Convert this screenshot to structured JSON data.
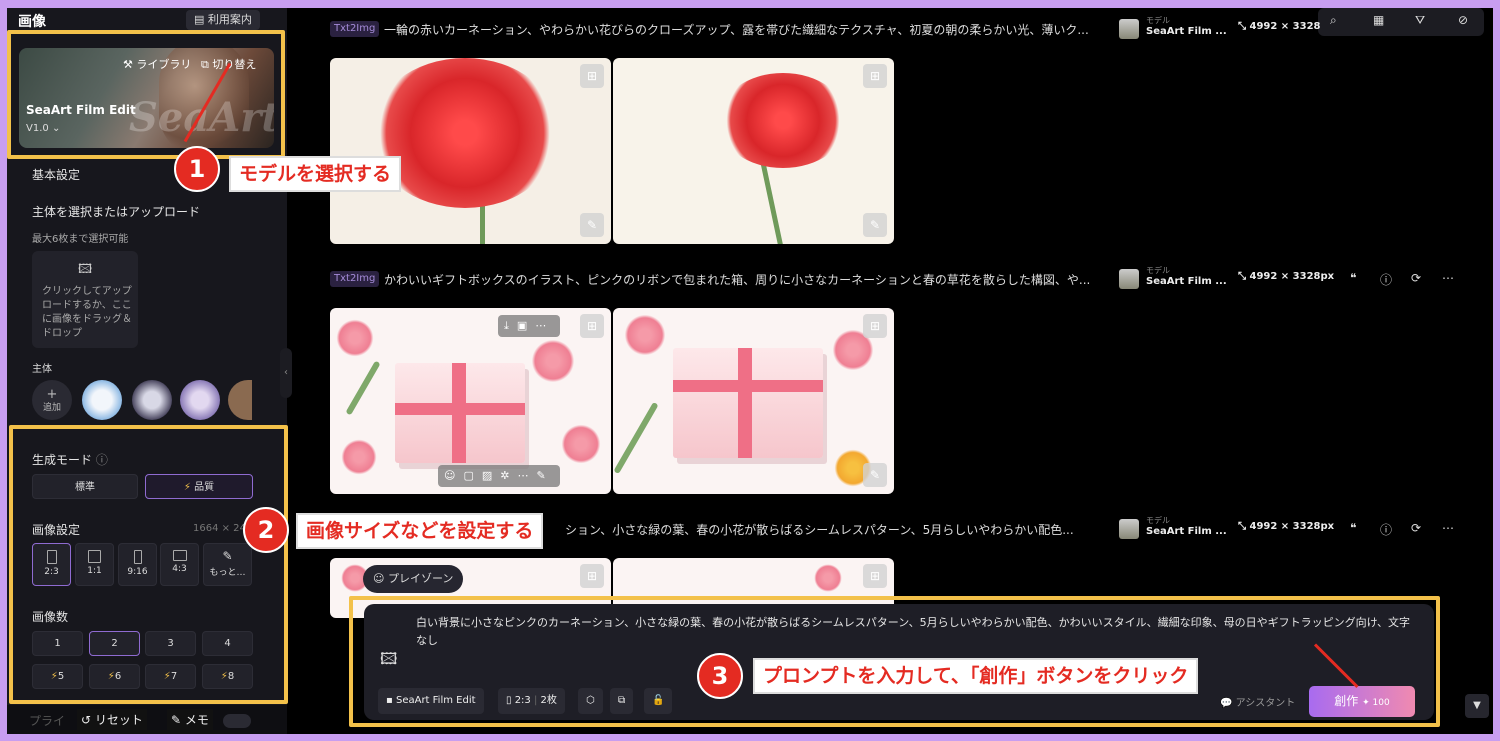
{
  "sidebar": {
    "title": "画像",
    "guide": "利用案内",
    "model_card": {
      "library": "ライブラリ",
      "switch": "切り替え",
      "name": "SeaArt Film Edit",
      "version": "V1.0",
      "watermark": "SeaArt"
    },
    "basic_settings": "基本設定",
    "subject_label": "主体を選択またはアップロード",
    "subject_limit": "最大6枚まで選択可能",
    "upload_text": "クリックしてアップロードするか、ここに画像をドラッグ＆ドロップ",
    "subject": "主体",
    "add": "追加",
    "gen_mode": "生成モード",
    "modes": [
      "標準",
      "品質"
    ],
    "image_settings": "画像設定",
    "image_size_hint": "1664 × 24",
    "ratios": [
      "2:3",
      "1:1",
      "9:16",
      "4:3",
      "もっと…"
    ],
    "image_count": "画像数",
    "counts": [
      "1",
      "2",
      "3",
      "4"
    ],
    "counts_premium": [
      "5",
      "6",
      "7",
      "8"
    ],
    "reset": "リセット",
    "memo": "メモ",
    "private": "プライ"
  },
  "feed": [
    {
      "badge": "Txt2Img",
      "prompt": "一輪の赤いカーネーション、やわらかい花びらのクローズアップ、露を帯びた繊細なテクスチャ、初夏の朝の柔らかい光、薄いク...",
      "model_label": "モデル",
      "model": "SeaArt Film ...",
      "size": "4992 × 3328"
    },
    {
      "badge": "Txt2Img",
      "prompt": "かわいいギフトボックスのイラスト、ピンクのリボンで包まれた箱、周りに小さなカーネーションと春の草花を散らした構図、や...",
      "model_label": "モデル",
      "model": "SeaArt Film ...",
      "size": "4992 × 3328px"
    },
    {
      "badge": "",
      "prompt": "ション、小さな緑の葉、春の小花が散らばるシームレスパターン、5月らしいやわらかい配色...",
      "model_label": "モデル",
      "model": "SeaArt Film ...",
      "size": "4992 × 3328px"
    }
  ],
  "composer": {
    "playzone": "プレイゾーン",
    "prompt": "白い背景に小さなピンクのカーネーション、小さな緑の葉、春の小花が散らばるシームレスパターン、5月らしいやわらかい配色、かわいいスタイル、繊細な印象、母の日やギフトラッピング向け、文字なし",
    "model_chip": "SeaArt Film Edit",
    "ratio_chip": "2:3",
    "count_chip": "2枚",
    "assistant": "アシスタント",
    "create": "創作",
    "cost": "100"
  },
  "annotations": [
    {
      "num": "1",
      "text": "モデルを選択する"
    },
    {
      "num": "2",
      "text": "画像サイズなどを設定する"
    },
    {
      "num": "3",
      "text": "プロンプトを入力して、「創作」ボタンをクリック"
    }
  ],
  "colors": {
    "accent": "#8f6bd1",
    "highlight": "#f3c14a",
    "marker": "#e42b22",
    "frame": "#c89ef0"
  }
}
